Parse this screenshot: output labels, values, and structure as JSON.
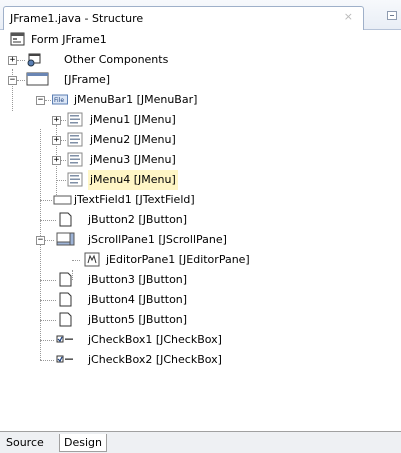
{
  "window": {
    "tab_title": "JFrame1.java - Structure",
    "close_glyph": "×"
  },
  "tree": {
    "nodes": [
      {
        "label": "Form JFrame1",
        "icon": "form-icon"
      },
      {
        "label": "Other Components",
        "icon": "components-icon",
        "expand": "+"
      },
      {
        "label": "[JFrame]",
        "icon": "frame-icon",
        "expand": "−"
      },
      {
        "label": "jMenuBar1 [JMenuBar]",
        "icon": "menubar-icon",
        "expand": "−",
        "icon_text": "File"
      },
      {
        "label": "jMenu1 [JMenu]",
        "icon": "menu-icon",
        "expand": "+"
      },
      {
        "label": "jMenu2 [JMenu]",
        "icon": "menu-icon",
        "expand": "+"
      },
      {
        "label": "jMenu3 [JMenu]",
        "icon": "menu-icon",
        "expand": "+"
      },
      {
        "label": "jMenu4 [JMenu]",
        "icon": "menu-icon",
        "selected": true
      },
      {
        "label": "jTextField1 [JTextField]",
        "icon": "textfield-icon"
      },
      {
        "label": "jButton2 [JButton]",
        "icon": "button-icon"
      },
      {
        "label": "jScrollPane1 [JScrollPane]",
        "icon": "scrollpane-icon",
        "expand": "−"
      },
      {
        "label": "jEditorPane1 [JEditorPane]",
        "icon": "editorpane-icon"
      },
      {
        "label": "jButton3 [JButton]",
        "icon": "button-icon"
      },
      {
        "label": "jButton4 [JButton]",
        "icon": "button-icon"
      },
      {
        "label": "jButton5 [JButton]",
        "icon": "button-icon"
      },
      {
        "label": "jCheckBox1 [JCheckBox]",
        "icon": "checkbox-icon"
      },
      {
        "label": "jCheckBox2 [JCheckBox]",
        "icon": "checkbox-icon"
      }
    ]
  },
  "bottom_tabs": [
    {
      "label": "Source",
      "active": false
    },
    {
      "label": "Design",
      "active": true
    }
  ]
}
